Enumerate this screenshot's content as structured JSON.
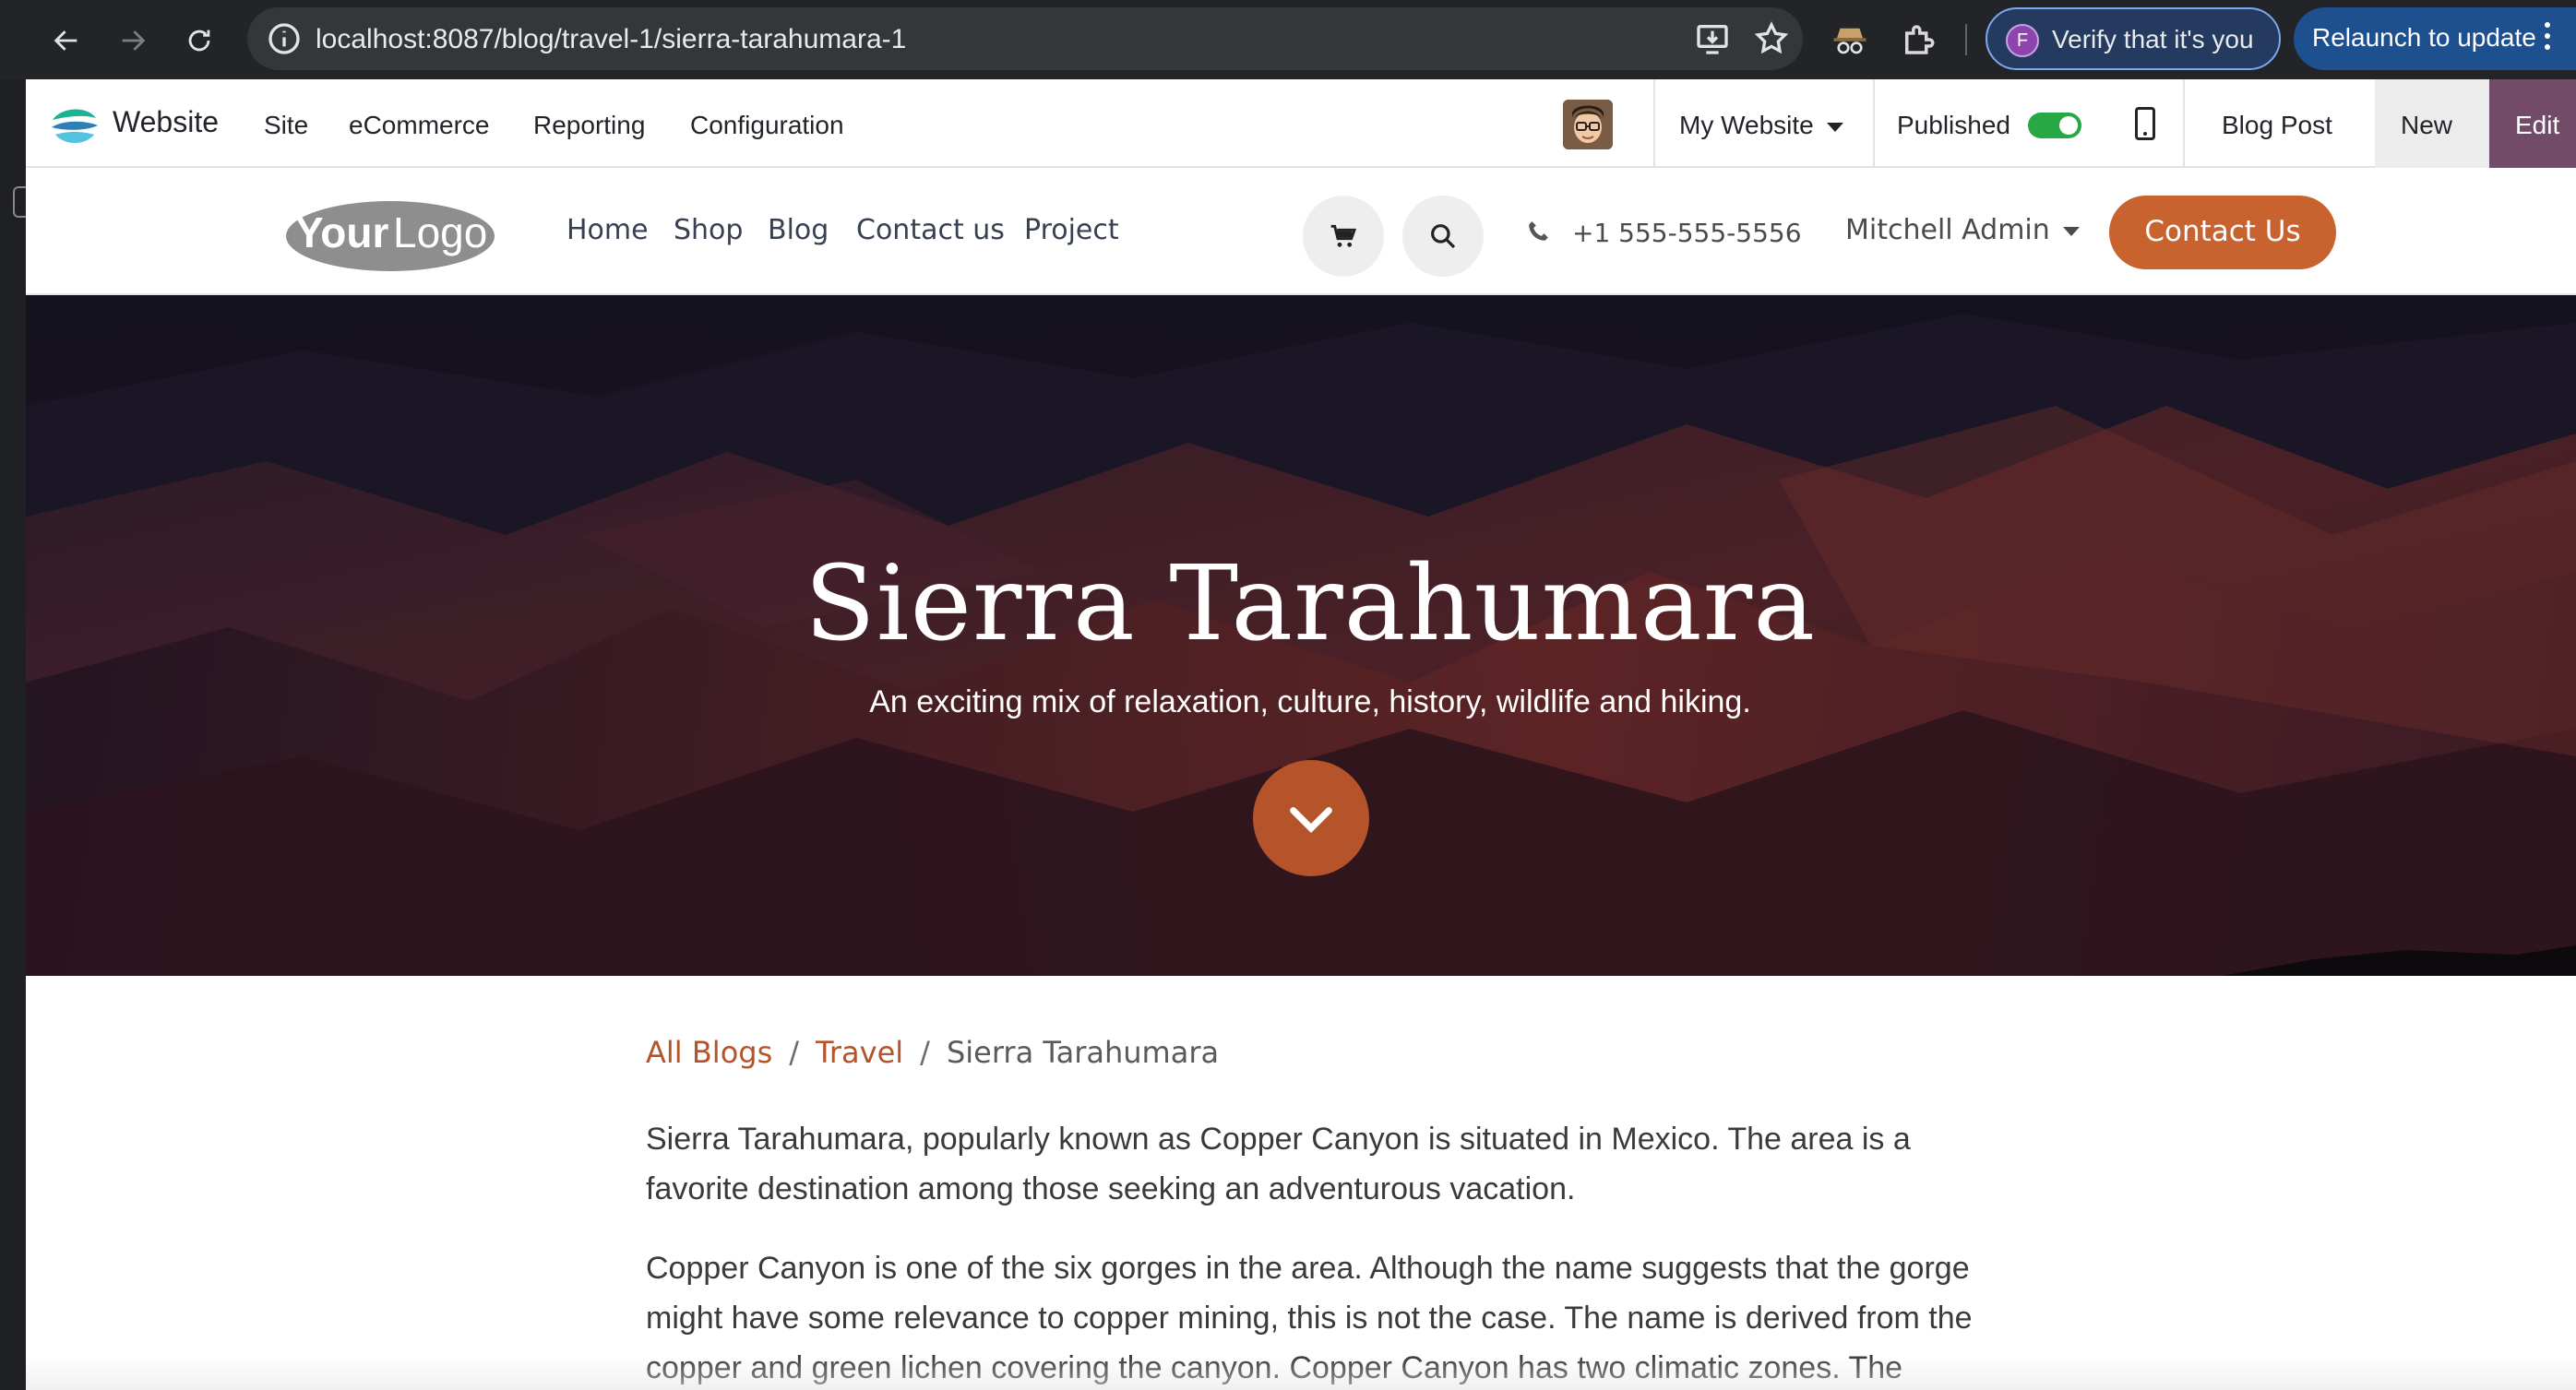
{
  "browser": {
    "url": "localhost:8087/blog/travel-1/sierra-tarahumara-1",
    "verify_label": "Verify that it's you",
    "verify_avatar_letter": "F",
    "relaunch_label": "Relaunch to update",
    "icons": [
      "back-arrow-icon",
      "forward-arrow-icon",
      "reload-icon",
      "info-icon",
      "install-app-icon",
      "bookmark-star-icon",
      "spy-extension-icon",
      "extensions-puzzle-icon",
      "more-menu-icon"
    ]
  },
  "admin_bar": {
    "brand": "Website",
    "menu": [
      "Site",
      "eCommerce",
      "Reporting",
      "Configuration"
    ],
    "website_selector": "My Website",
    "published_label": "Published",
    "published": true,
    "page_type": "Blog Post",
    "new_label": "New",
    "edit_label": "Edit",
    "accent_color": "#714b67"
  },
  "site_header": {
    "logo_text": "YourLogo",
    "nav": [
      "Home",
      "Shop",
      "Blog",
      "Contact us",
      "Project"
    ],
    "phone": "+1 555-555-5556",
    "user": "Mitchell Admin",
    "cta": "Contact Us",
    "cta_color": "#c8622f"
  },
  "hero": {
    "title": "Sierra Tarahumara",
    "subtitle": "An exciting mix of relaxation, culture, history, wildlife and hiking."
  },
  "breadcrumb": {
    "items": [
      "All Blogs",
      "Travel"
    ],
    "current": "Sierra Tarahumara",
    "link_color": "#b5532a"
  },
  "article": {
    "paragraph1": [
      "Sierra Tarahumara, popularly known as Copper Canyon is situated in Mexico. The area is a",
      "favorite destination among those seeking an adventurous vacation."
    ],
    "paragraph2": [
      "Copper Canyon is one of the six gorges in the area. Although the name suggests that the gorge",
      "might have some relevance to copper mining, this is not the case. The name is derived from the",
      "copper and green lichen covering the canyon. Copper Canyon has two climatic zones. The"
    ]
  }
}
